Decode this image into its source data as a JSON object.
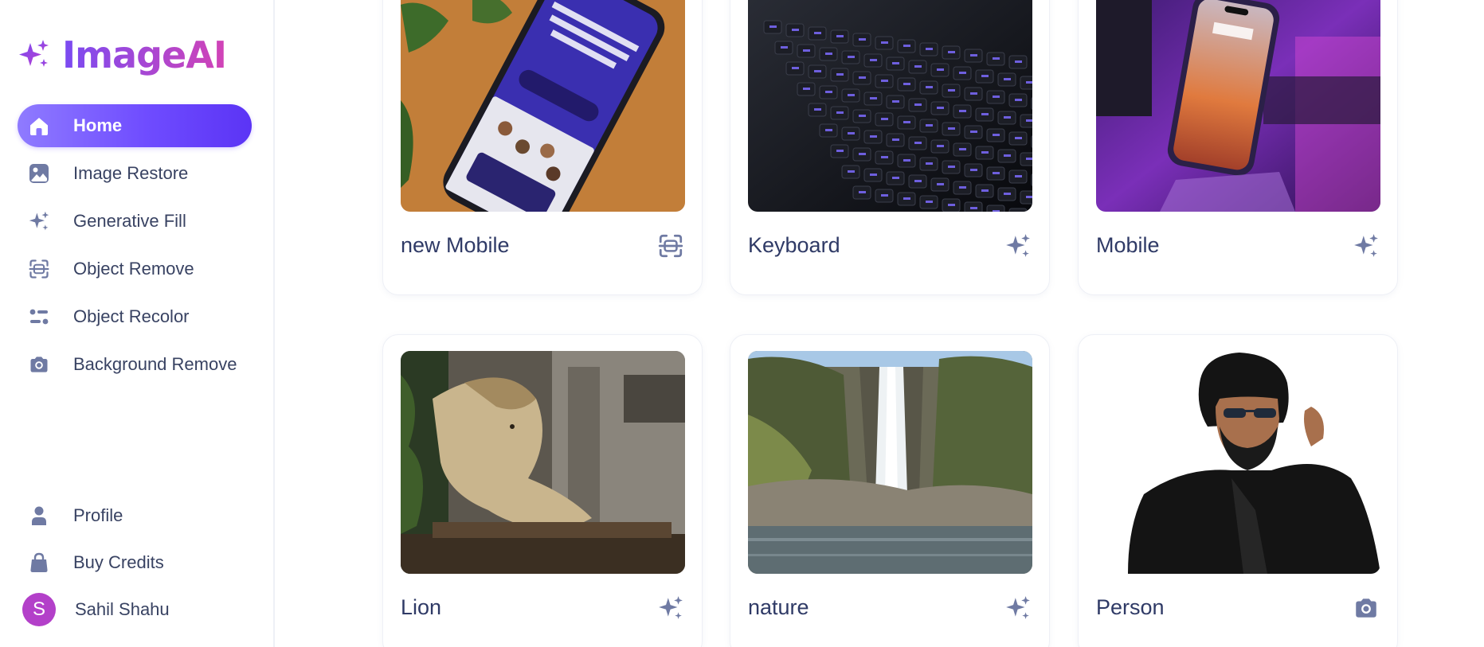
{
  "app": {
    "name": "ImageAI",
    "brand_gradient": [
      "#7a4bf2",
      "#d243b6"
    ],
    "accent": "#6f4cff"
  },
  "sidebar": {
    "nav": [
      {
        "label": "Home",
        "icon": "home-icon",
        "active": true
      },
      {
        "label": "Image Restore",
        "icon": "image-icon",
        "active": false
      },
      {
        "label": "Generative Fill",
        "icon": "sparkles-icon",
        "active": false
      },
      {
        "label": "Object Remove",
        "icon": "scan-icon",
        "active": false
      },
      {
        "label": "Object Recolor",
        "icon": "filter-icon",
        "active": false
      },
      {
        "label": "Background Remove",
        "icon": "camera-icon",
        "active": false
      }
    ],
    "bottom": [
      {
        "label": "Profile",
        "icon": "user-icon"
      },
      {
        "label": "Buy Credits",
        "icon": "bag-icon"
      }
    ],
    "user": {
      "initial": "S",
      "name": "Sahil Shahu",
      "avatar_color": "#b340c9"
    }
  },
  "gallery": [
    {
      "title": "new Mobile",
      "image": "phone-on-desk-photo",
      "action_icon": "scan-icon"
    },
    {
      "title": "Keyboard",
      "image": "keyboard-photo",
      "action_icon": "sparkles-icon"
    },
    {
      "title": "Mobile",
      "image": "phone-on-stand-photo",
      "action_icon": "sparkles-icon"
    },
    {
      "title": "Lion",
      "image": "lion-photo",
      "action_icon": "sparkles-icon"
    },
    {
      "title": "nature",
      "image": "waterfall-photo",
      "action_icon": "sparkles-icon"
    },
    {
      "title": "Person",
      "image": "person-photo",
      "action_icon": "camera-icon"
    }
  ]
}
